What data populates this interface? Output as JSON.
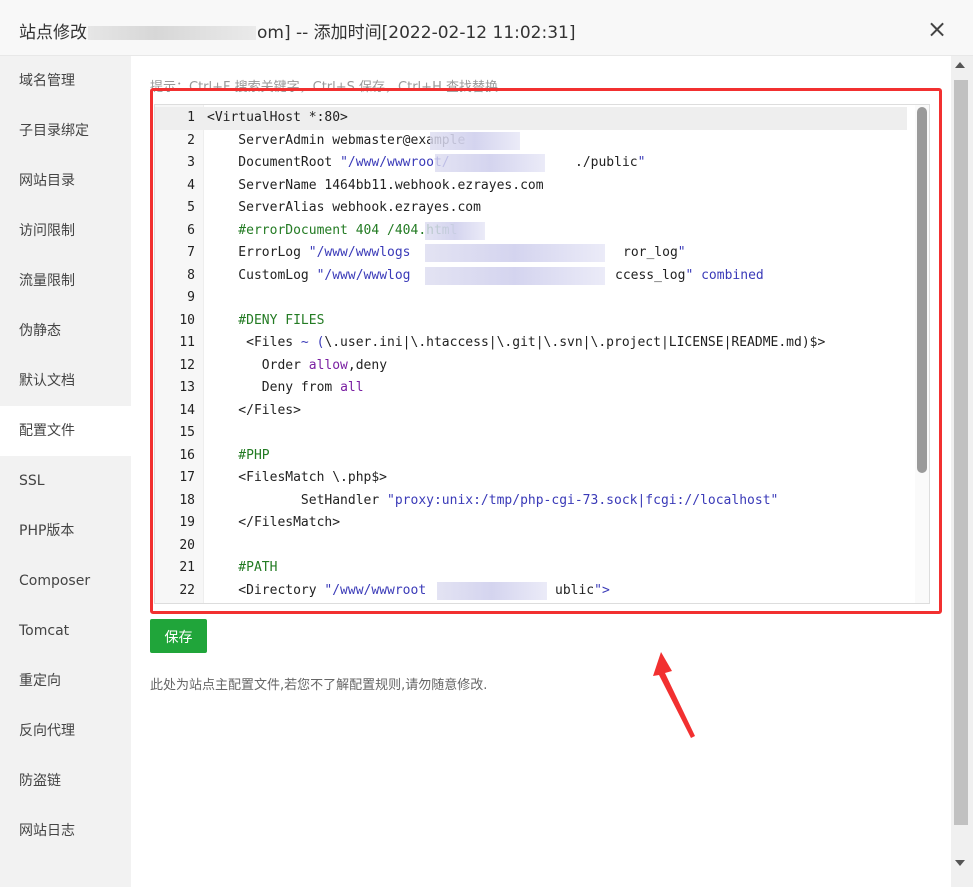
{
  "dialog": {
    "title_prefix": "站点修改",
    "title_suffix": "om] -- 添加时间[2022-02-12 11:02:31]",
    "close_label": "×"
  },
  "sidebar": {
    "items": [
      {
        "label": "域名管理",
        "active": false
      },
      {
        "label": "子目录绑定",
        "active": false
      },
      {
        "label": "网站目录",
        "active": false
      },
      {
        "label": "访问限制",
        "active": false
      },
      {
        "label": "流量限制",
        "active": false
      },
      {
        "label": "伪静态",
        "active": false
      },
      {
        "label": "默认文档",
        "active": false
      },
      {
        "label": "配置文件",
        "active": true
      },
      {
        "label": "SSL",
        "active": false
      },
      {
        "label": "PHP版本",
        "active": false
      },
      {
        "label": "Composer",
        "active": false
      },
      {
        "label": "Tomcat",
        "active": false
      },
      {
        "label": "重定向",
        "active": false
      },
      {
        "label": "反向代理",
        "active": false
      },
      {
        "label": "防盗链",
        "active": false
      },
      {
        "label": "网站日志",
        "active": false
      }
    ]
  },
  "main": {
    "hint": "提示：Ctrl+F 搜索关键字，Ctrl+S 保存，Ctrl+H 查找替换",
    "save_label": "保存",
    "note": "此处为站点主配置文件,若您不了解配置规则,请勿随意修改.",
    "editor": {
      "lines": [
        {
          "num": "1",
          "text": "<VirtualHost *:80>"
        },
        {
          "num": "2",
          "text": "    ServerAdmin webmaster@example"
        },
        {
          "num": "3",
          "text": "    DocumentRoot \"/www/wwwroot/"
        },
        {
          "num": "4",
          "text": "    ServerName 1464bb11.webhook.ezrayes.com"
        },
        {
          "num": "5",
          "text": "    ServerAlias webhook.ezrayes.com"
        },
        {
          "num": "6",
          "text": "    #errorDocument 404 /404.html"
        },
        {
          "num": "7",
          "text": "    ErrorLog \"/www/wwwlogs"
        },
        {
          "num": "8",
          "text": "    CustomLog \"/www/wwwlog"
        },
        {
          "num": "9",
          "text": ""
        },
        {
          "num": "10",
          "text": "    #DENY FILES"
        },
        {
          "num": "11",
          "text": "     <Files ~ (\\.user.ini|\\.htaccess|\\.git|\\.svn|\\.project|LICENSE|README.md)$>"
        },
        {
          "num": "12",
          "text": "       Order allow,deny"
        },
        {
          "num": "13",
          "text": "       Deny from all"
        },
        {
          "num": "14",
          "text": "    </Files>"
        },
        {
          "num": "15",
          "text": ""
        },
        {
          "num": "16",
          "text": "    #PHP"
        },
        {
          "num": "17",
          "text": "    <FilesMatch \\.php$>"
        },
        {
          "num": "18",
          "text": "            SetHandler \"proxy:unix:/tmp/php-cgi-73.sock|fcgi://localhost\""
        },
        {
          "num": "19",
          "text": "    </FilesMatch>"
        },
        {
          "num": "20",
          "text": ""
        },
        {
          "num": "21",
          "text": "    #PATH"
        },
        {
          "num": "22",
          "text": "    <Directory \"/www/wwwroot"
        }
      ],
      "line_tails": {
        "3": "./public\"",
        "7": "ror_log\"",
        "8": "ccess_log\" combined",
        "22": "ublic\">"
      }
    }
  },
  "colors": {
    "accent_green": "#20a53a",
    "highlight_red": "#f23030",
    "string_blue": "#3a3ab8",
    "comment_green": "#237b23"
  }
}
